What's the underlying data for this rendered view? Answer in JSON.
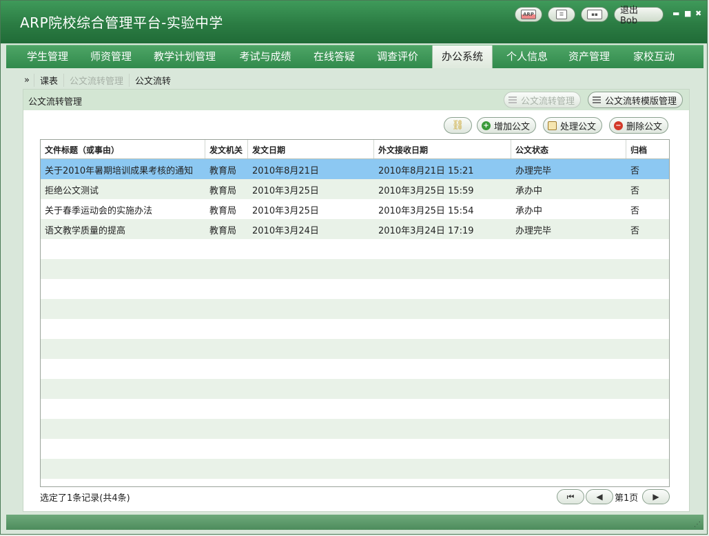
{
  "app": {
    "title": "ARP院校综合管理平台-实验中学",
    "logout_label": "退出 Bob",
    "toolbar_icons": [
      "arp-icon",
      "list-icon",
      "keyboard-icon"
    ]
  },
  "nav": {
    "items": [
      {
        "label": "学生管理"
      },
      {
        "label": "师资管理"
      },
      {
        "label": "教学计划管理"
      },
      {
        "label": "考试与成绩"
      },
      {
        "label": "在线答疑"
      },
      {
        "label": "调查评价"
      },
      {
        "label": "办公系统",
        "active": true
      },
      {
        "label": "个人信息"
      },
      {
        "label": "资产管理"
      },
      {
        "label": "家校互动"
      }
    ]
  },
  "breadcrumb": {
    "prefix": "»",
    "items": [
      "课表",
      "公文流转管理",
      "公文流转"
    ]
  },
  "panel": {
    "title": "公文流转管理",
    "head_buttons": {
      "manage": "公文流转管理",
      "template": "公文流转模版管理"
    },
    "actions": {
      "add": "增加公文",
      "process": "处理公文",
      "delete": "删除公文"
    }
  },
  "table": {
    "columns": [
      "文件标题（或事由）",
      "发文机关",
      "发文日期",
      "外文接收日期",
      "公文状态",
      "归档"
    ],
    "rows": [
      [
        "关于2010年暑期培训成果考核的通知",
        "教育局",
        "2010年8月21日",
        "2010年8月21日 15:21",
        "办理完毕",
        "否"
      ],
      [
        "拒绝公文测试",
        "教育局",
        "2010年3月25日",
        "2010年3月25日 15:59",
        "承办中",
        "否"
      ],
      [
        "关于春季运动会的实施办法",
        "教育局",
        "2010年3月25日",
        "2010年3月25日 15:54",
        "承办中",
        "否"
      ],
      [
        "语文教学质量的提高",
        "教育局",
        "2010年3月24日",
        "2010年3月24日 17:19",
        "办理完毕",
        "否"
      ]
    ],
    "selected_row": 0,
    "footer_status": "选定了1条记录(共4条)",
    "page_label": "第1页"
  },
  "colors": {
    "title_green": "#2b7c43",
    "nav_green": "#318a4c",
    "selected_row": "#8cc8f2",
    "alt_row": "#e9f2e8"
  }
}
